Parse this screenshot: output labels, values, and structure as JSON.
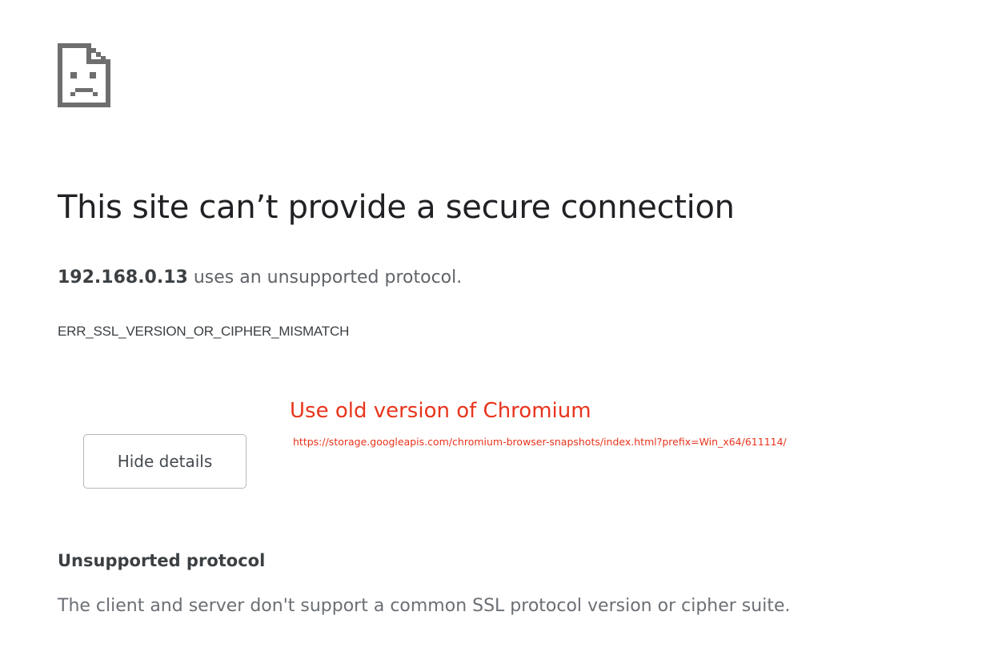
{
  "error_page": {
    "icon": "sad-page-icon",
    "title": "This site can’t provide a secure connection",
    "summary_host": "192.168.0.13",
    "summary_text": " uses an unsupported protocol.",
    "error_code": "ERR_SSL_VERSION_OR_CIPHER_MISMATCH",
    "details_button_label": "Hide details",
    "details_heading": "Unsupported protocol",
    "details_body": "The client and server don't support a common SSL protocol version or cipher suite."
  },
  "annotation": {
    "title": "Use old version of Chromium",
    "url": "https://storage.googleapis.com/chromium-browser-snapshots/index.html?prefix=Win_x64/611114/",
    "color": "#e8341c"
  },
  "colors": {
    "title_text": "#202124",
    "body_text": "#5f6368",
    "icon": "#6e6e6e"
  }
}
